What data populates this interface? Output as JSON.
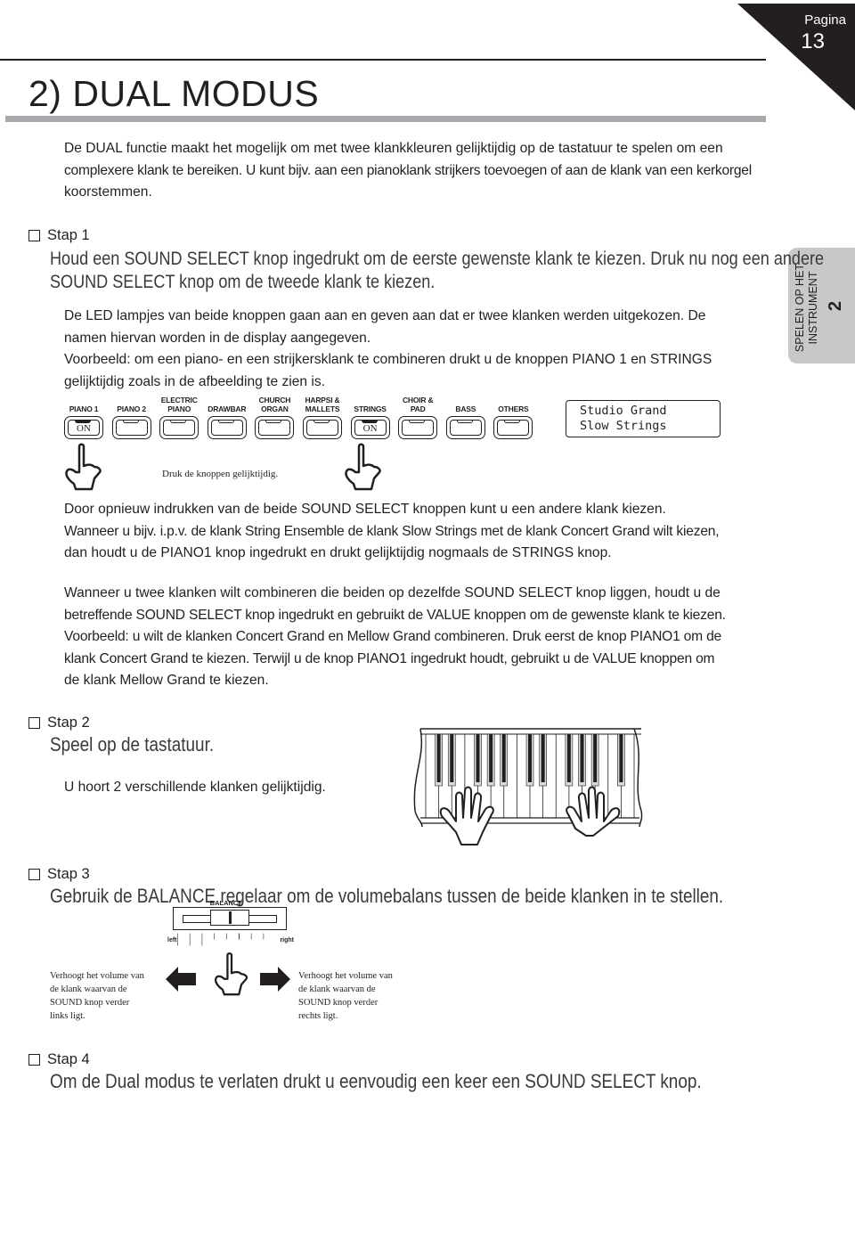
{
  "header": {
    "page_label": "Pagina",
    "page_number": "13",
    "title": "2) DUAL MODUS"
  },
  "side_tab": {
    "label_line1": "SPELEN OP HET",
    "label_line2": "INSTRUMENT",
    "chapter_number": "2"
  },
  "intro": {
    "line1": "De DUAL functie maakt het mogelijk om met twee klankkleuren gelijktijdig op de tastatuur te spelen om een",
    "line2": "complexere klank te bereiken. U kunt bijv. aan een pianoklank strijkers toevoegen of aan de klank van een kerkorgel",
    "line3": "koorstemmen."
  },
  "step1": {
    "heading": "Stap 1",
    "instruction_line1": "Houd een SOUND SELECT knop ingedrukt om de eerste gewenste klank te kiezen. Druk nu nog een andere",
    "instruction_line2": "SOUND SELECT knop om de tweede klank te kiezen.",
    "para1_line1": "De LED lampjes van beide knoppen gaan aan en geven aan dat er twee klanken werden uitgekozen. De",
    "para1_line2": "namen hiervan worden in de display aangegeven.",
    "para2_line1": "Voorbeeld: om een piano- en een strijkersklank te combineren drukt u de knoppen PIANO 1 en STRINGS",
    "para2_line2": "gelijktijdig zoals in de afbeelding te zien is.",
    "buttons": [
      {
        "label1": "",
        "label2": "PIANO 1",
        "on": true,
        "on_text": "ON"
      },
      {
        "label1": "",
        "label2": "PIANO 2",
        "on": false,
        "on_text": ""
      },
      {
        "label1": "ELECTRIC",
        "label2": "PIANO",
        "on": false,
        "on_text": ""
      },
      {
        "label1": "",
        "label2": "DRAWBAR",
        "on": false,
        "on_text": ""
      },
      {
        "label1": "CHURCH",
        "label2": "ORGAN",
        "on": false,
        "on_text": ""
      },
      {
        "label1": "HARPSI &",
        "label2": "MALLETS",
        "on": false,
        "on_text": ""
      },
      {
        "label1": "",
        "label2": "STRINGS",
        "on": true,
        "on_text": "ON"
      },
      {
        "label1": "CHOIR &",
        "label2": "PAD",
        "on": false,
        "on_text": ""
      },
      {
        "label1": "",
        "label2": "BASS",
        "on": false,
        "on_text": ""
      },
      {
        "label1": "",
        "label2": "OTHERS",
        "on": false,
        "on_text": ""
      }
    ],
    "display": {
      "line1": "Studio Grand",
      "line2": "Slow Strings"
    },
    "press_caption": "Druk de knoppen gelijktijdig.",
    "para3_line1": "Door opnieuw indrukken van de beide SOUND SELECT knoppen kunt u een andere klank kiezen.",
    "para3_line2": "Wanneer u bijv. i.p.v. de klank String Ensemble de klank Slow Strings met de klank Concert Grand wilt kiezen,",
    "para3_line3": "dan houdt u de PIANO1 knop ingedrukt en drukt gelijktijdig nogmaals de STRINGS knop.",
    "para4_line1": "Wanneer u twee klanken wilt combineren die beiden op dezelfde SOUND SELECT knop liggen, houdt u de",
    "para4_line2": "betreffende SOUND SELECT knop ingedrukt en gebruikt de VALUE knoppen om de gewenste klank te kiezen.",
    "para4_line3": "Voorbeeld: u wilt de klanken Concert Grand en Mellow Grand combineren. Druk eerst de knop PIANO1 om de",
    "para4_line4": "klank Concert Grand te kiezen. Terwijl u de knop PIANO1 ingedrukt houdt, gebruikt u de VALUE knoppen om",
    "para4_line5": "de klank Mellow Grand te kiezen."
  },
  "step2": {
    "heading": "Stap 2",
    "instruction": "Speel op de tastatuur.",
    "note": "U hoort 2 verschillende klanken gelijktijdig."
  },
  "step3": {
    "heading": "Stap 3",
    "instruction": "Gebruik de BALANCE regelaar om de volumebalans tussen de beide klanken in te stellen.",
    "slider": {
      "title": "BALANCE",
      "left_label": "left",
      "right_label": "right",
      "position": 0.5
    },
    "left_note": [
      "Verhoogt het volume van",
      "de klank waarvan de",
      "SOUND knop verder",
      "links ligt."
    ],
    "right_note": [
      "Verhoogt het volume van",
      "de klank waarvan de",
      "SOUND knop verder",
      "rechts ligt."
    ]
  },
  "step4": {
    "heading": "Stap 4",
    "instruction": "Om de Dual modus te verlaten drukt u eenvoudig een keer een SOUND SELECT knop."
  }
}
